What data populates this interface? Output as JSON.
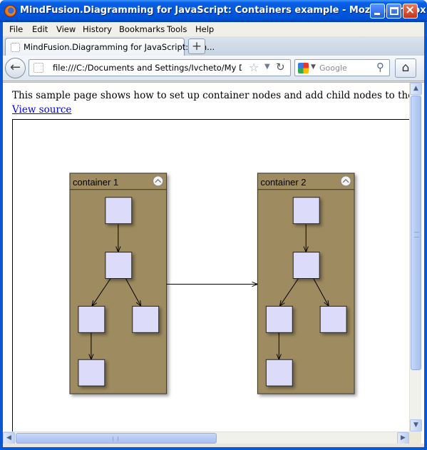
{
  "window": {
    "title": "MindFusion.Diagramming for JavaScript: Containers example - Mozilla Firefox"
  },
  "menu": [
    "File",
    "Edit",
    "View",
    "History",
    "Bookmarks",
    "Tools",
    "Help"
  ],
  "tab": {
    "title": "MindFusion.Diagramming for JavaScript: Con...",
    "close": "×",
    "new_tab": "+"
  },
  "nav": {
    "back": "←",
    "url": "file:///C:/Documents and Settings/Ivcheto/My Documen",
    "star": "☆",
    "dropdown": "▼",
    "reload": "↻",
    "search_dropdown": "▼",
    "search_placeholder": "Google",
    "search_go": "⚲",
    "home": "⌂"
  },
  "page": {
    "intro": "This sample page shows how to set up container nodes and add child nodes to them.",
    "view_source": "View source"
  },
  "diagram": {
    "container_fill": "#9e8b5e",
    "node_fill": "#dcdcfa",
    "containers": [
      {
        "caption": "container 1"
      },
      {
        "caption": "container 2"
      }
    ]
  },
  "scroll": {
    "up": "▲",
    "down": "▼",
    "left": "◀",
    "right": "▶"
  }
}
